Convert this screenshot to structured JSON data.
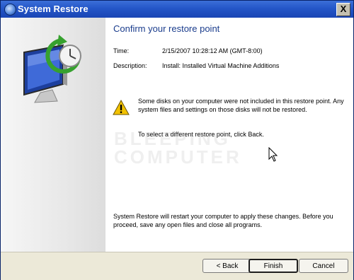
{
  "window": {
    "title": "System Restore",
    "close_glyph": "X"
  },
  "left_panel": {
    "icon": "system-restore-monitor-icon"
  },
  "content": {
    "heading": "Confirm your restore point",
    "time_label": "Time:",
    "time_value": "2/15/2007 10:28:12 AM (GMT-8:00)",
    "description_label": "Description:",
    "description_value": "Install: Installed Virtual Machine Additions",
    "warning_text": "Some disks on your computer were not included in this restore point. Any system files and settings on those disks will not be restored.",
    "back_hint": "To select a different restore point, click Back.",
    "bottom_text": "System Restore will restart your computer to apply these changes. Before you proceed, save any open files and close all programs.",
    "watermark_line1": "BLEEPING",
    "watermark_line2": "COMPUTER"
  },
  "footer": {
    "back_label": "< Back",
    "finish_label": "Finish",
    "cancel_label": "Cancel"
  },
  "colors": {
    "title_bar": "#2456c8",
    "heading": "#1a3c8c",
    "warning": "#f2c200"
  }
}
